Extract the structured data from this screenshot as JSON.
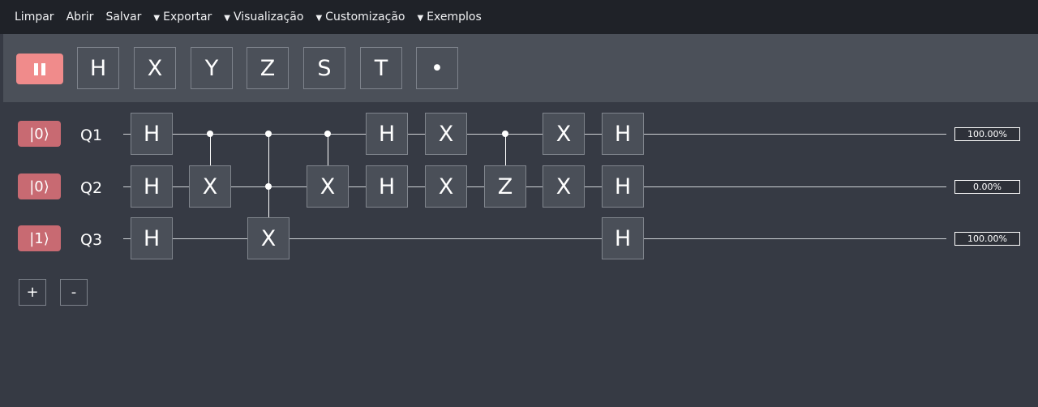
{
  "menu": {
    "limpar": "Limpar",
    "abrir": "Abrir",
    "salvar": "Salvar",
    "exportar": "Exportar",
    "visualizacao": "Visualização",
    "customizacao": "Customização",
    "exemplos": "Exemplos",
    "caret": "▼"
  },
  "toolbar": {
    "gates": [
      "H",
      "X",
      "Y",
      "Z",
      "S",
      "T",
      "•"
    ]
  },
  "qubits": [
    {
      "state": "|0⟩",
      "label": "Q1",
      "probability": "100.00%"
    },
    {
      "state": "|0⟩",
      "label": "Q2",
      "probability": "0.00%"
    },
    {
      "state": "|1⟩",
      "label": "Q3",
      "probability": "100.00%"
    }
  ],
  "gates": {
    "c1_q1": "H",
    "c1_q2": "H",
    "c1_q3": "H",
    "c2_q2": "X",
    "c3_q3": "X",
    "c4_q2": "X",
    "c5_q1": "H",
    "c5_q2": "H",
    "c6_q1": "X",
    "c6_q2": "X",
    "c7_q2": "Z",
    "c8_q1": "X",
    "c8_q2": "X",
    "c9_q1": "H",
    "c9_q2": "H",
    "c9_q3": "H"
  },
  "controls": {
    "add_qubit": "+",
    "remove_qubit": "-"
  },
  "colors": {
    "pause": "#f08b8b",
    "state_button": "#c86a72",
    "menubar": "#1f2228",
    "toolbar": "#4b5059",
    "background": "#363a44"
  }
}
